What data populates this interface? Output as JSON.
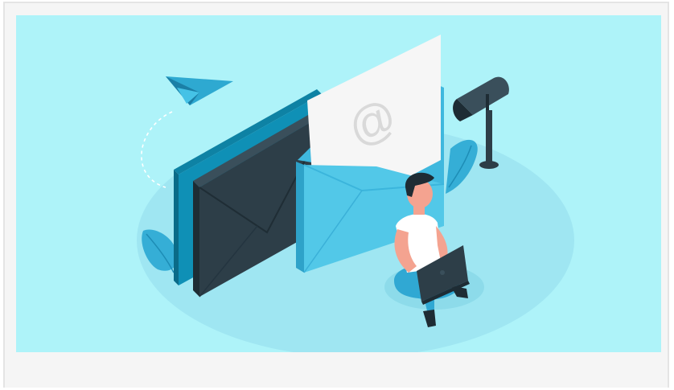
{
  "illustration": {
    "subject": "email-communication",
    "envelope_symbol": "@",
    "colors": {
      "background": "#aef3f9",
      "floor": "#9fe6f2",
      "accent": "#4fc6e6",
      "dark": "#2d3e48",
      "paper": "#f6f6f6",
      "skin": "#f4a390"
    }
  }
}
